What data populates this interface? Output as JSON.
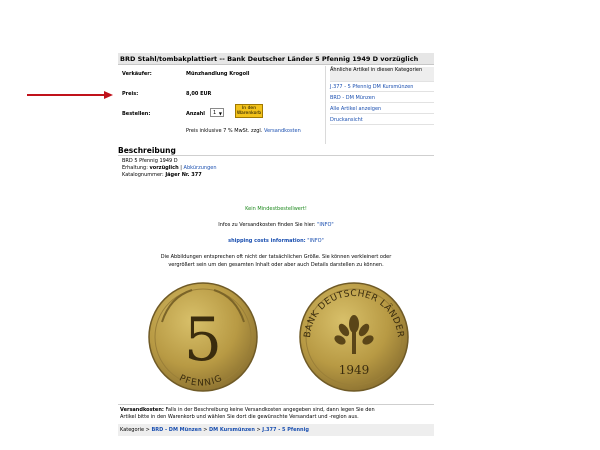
{
  "title": "BRD Stahl/tombakplattiert -- Bank Deutscher Länder 5 Pfennig 1949 D vorzüglich",
  "details": {
    "seller_label": "Verkäufer:",
    "seller_value": "Münzhandlung Krogoll",
    "price_label": "Preis:",
    "price_value": "8,00 EUR",
    "order_label": "Bestellen:",
    "quantity_label": "Anzahl",
    "quantity_value": "1",
    "cart_button_line1": "In den",
    "cart_button_line2": "Warenkorb",
    "tax_note": "Preis inklusive 7 % MwSt. zzgl.",
    "shipping_link": "Versandkosten"
  },
  "sidebar": {
    "header": "Ähnliche Artikel in diesen Kategorien",
    "links": [
      "J.377 - 5 Pfennig DM Kursmünzen",
      "BRD - DM Münzen",
      "Alle Artikel anzeigen",
      "Druckansicht"
    ]
  },
  "description": {
    "header": "Beschreibung",
    "line1": "BRD 5 Pfennig 1949 D",
    "condition_label": "Erhaltung:",
    "condition_value": "vorzüglich",
    "separator": "|",
    "abbrev_link": "Abkürzungen",
    "catalog_label": "Katalognummer:",
    "catalog_value": "Jäger Nr. 377",
    "no_minimum": "Kein Mindestbestellwert!",
    "info_shipping_prefix": "Infos zu Versandkosten finden Sie hier:",
    "info_link": "\"INFO\"",
    "shipping_costs_label": "shipping costs information:",
    "shipping_costs_link": "\"INFO\"",
    "disclaimer_line1": "Die Abbildungen entsprechen oft nicht der tatsächlichen Größe. Sie können verkleinert oder",
    "disclaimer_line2": "vergrößert sein um den gesamten Inhalt oder aber auch Details darstellen zu können."
  },
  "coins": {
    "obverse_number": "5",
    "obverse_text": "PFENNIG",
    "reverse_text": "BANK DEUTSCHER LÄNDER",
    "reverse_year": "1949"
  },
  "footer": {
    "shipping_label": "Versandkosten:",
    "shipping_text_line1": "Falls in der Beschreibung keine Versandkosten angegeben sind, dann legen Sie den",
    "shipping_text_line2": "Artikel bitte in den Warenkorb und wählen Sie dort die gewünschte Versandart und -region aus.",
    "breadcrumb_prefix": "Kategorie",
    "breadcrumb_sep": ">",
    "breadcrumb_items": [
      "BRD - DM Münzen",
      "DM Kursmünzen",
      "J.377 - 5 Pfennig"
    ]
  },
  "colors": {
    "arrow": "#c0121b",
    "link": "#1a4fb0",
    "cart_button": "#f2c21b"
  }
}
